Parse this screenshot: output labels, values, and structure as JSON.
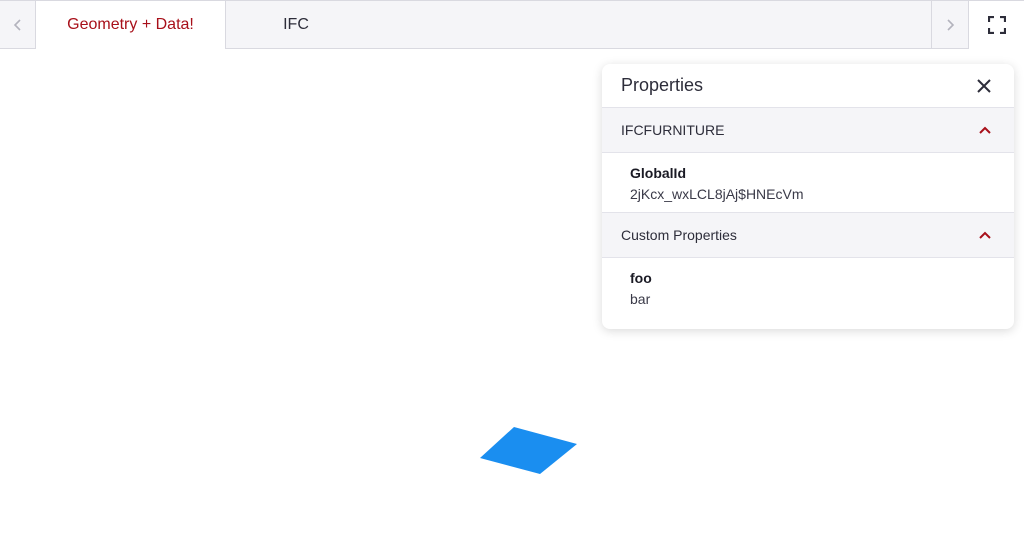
{
  "tabs": [
    {
      "label": "Geometry + Data!",
      "active": true
    },
    {
      "label": "IFC",
      "active": false
    }
  ],
  "icons": {
    "prev": "chevron-left-icon",
    "next": "chevron-right-icon",
    "fullscreen": "fullscreen-icon",
    "close": "close-icon",
    "collapse": "chevron-up-icon"
  },
  "properties_panel": {
    "title": "Properties",
    "sections": [
      {
        "header": "IFCFURNITURE",
        "key": "GlobalId",
        "value": "2jKcx_wxLCL8jAj$HNEcVm"
      },
      {
        "header": "Custom Properties",
        "key": "foo",
        "value": "bar"
      }
    ]
  },
  "colors": {
    "accent": "#a8101a",
    "shape": "#1a8ef0"
  }
}
